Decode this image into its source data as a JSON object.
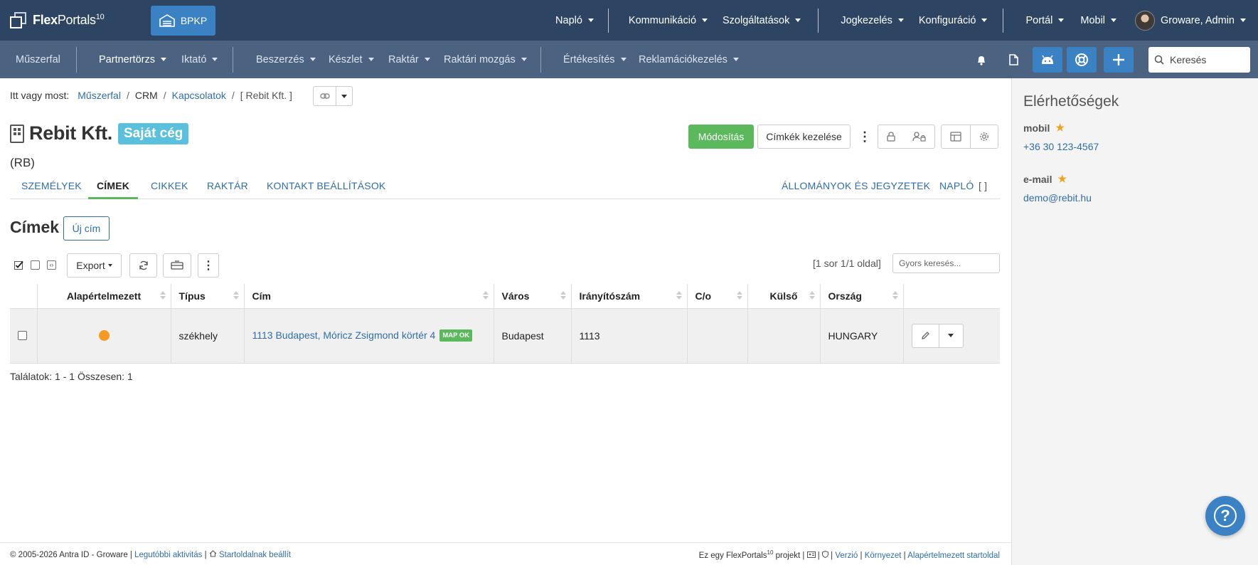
{
  "brand": {
    "name_bold": "Flex",
    "name_rest": "Portals",
    "version": "10"
  },
  "topbar": {
    "bpkp_label": "BPKP",
    "menus": [
      "Napló",
      "Kommunikáció",
      "Szolgáltatások",
      "Jogkezelés",
      "Konfiguráció",
      "Portál",
      "Mobil"
    ],
    "user": "Groware, Admin"
  },
  "navbar": {
    "dashboard": "Műszerfal",
    "items": [
      "Partnertörzs",
      "Iktató",
      "Beszerzés",
      "Készlet",
      "Raktár",
      "Raktári mozgás",
      "Értékesítés",
      "Reklamációkezelés"
    ],
    "search_placeholder": "Keresés"
  },
  "breadcrumb": {
    "prefix": "Itt vagy most:",
    "items": [
      "Műszerfal",
      "CRM",
      "Kapcsolatok",
      "[ Rebit Kft. ]"
    ]
  },
  "header": {
    "title": "Rebit Kft.",
    "badge": "Saját cég",
    "code": "(RB)",
    "modify": "Módosítás",
    "manage_labels": "Címkék kezelése"
  },
  "tabs": {
    "left": [
      "SZEMÉLYEK",
      "CÍMEK",
      "CIKKEK",
      "RAKTÁR",
      "KONTAKT BEÁLLÍTÁSOK"
    ],
    "right": [
      "ÁLLOMÁNYOK ÉS JEGYZETEK",
      "NAPLÓ"
    ],
    "active": "CÍMEK"
  },
  "section": {
    "title": "Címek",
    "new_button": "Új cím"
  },
  "toolbar": {
    "export": "Export",
    "pager": "[1 sor 1/1 oldal]",
    "quick_search_placeholder": "Gyors keresés..."
  },
  "table": {
    "columns": [
      "Alapértelmezett",
      "Típus",
      "Cím",
      "Város",
      "Irányítószám",
      "C/o",
      "Külső",
      "Ország"
    ],
    "rows": [
      {
        "default": true,
        "type": "székhely",
        "address": "1113 Budapest, Móricz Zsigmond körtér 4",
        "map_badge": "MAP OK",
        "city": "Budapest",
        "zip": "1113",
        "co": "",
        "external": "",
        "country": "HUNGARY"
      }
    ],
    "results": "Találatok: 1 - 1 Összesen: 1"
  },
  "side": {
    "title": "Elérhetőségek",
    "contacts": [
      {
        "label": "mobil",
        "value": "+36 30 123-4567"
      },
      {
        "label": "e-mail",
        "value": "demo@rebit.hu"
      }
    ]
  },
  "footer": {
    "copyright": "© 2005-2026 Antra ID - Groware |",
    "recent": "Legutóbbi aktivitás",
    "sep": "|",
    "set_home": "Startoldalnak beállít",
    "project_prefix": "Ez egy FlexPortals",
    "project_version": "10",
    "project_suffix": "projekt |",
    "links": [
      "Verzió",
      "Környezet",
      "Alapértelmezett startoldal"
    ]
  },
  "colors": {
    "topbar": "#2d4463",
    "navbar": "#4b6281",
    "accent": "#3b82c4",
    "success": "#5cb85c",
    "badge": "#5bc0de",
    "dot": "#f59a23"
  }
}
